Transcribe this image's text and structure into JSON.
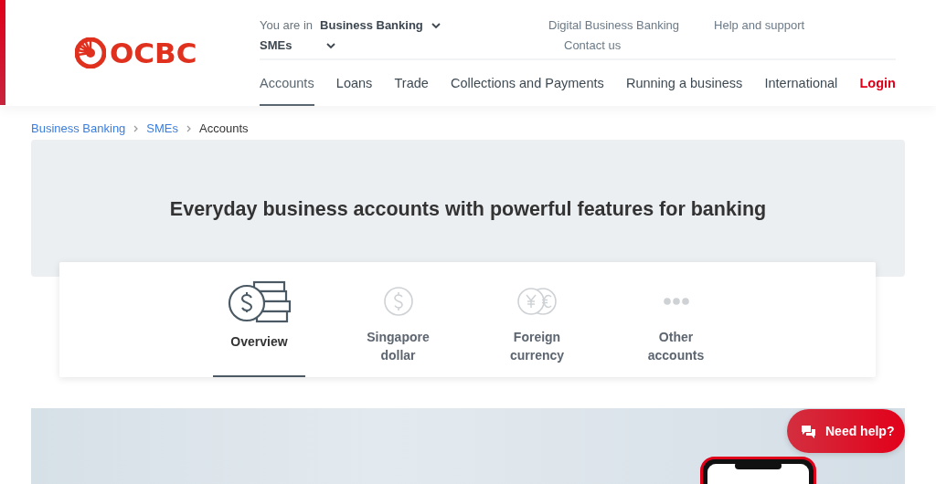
{
  "header": {
    "logo_text": "OCBC",
    "context_label": "You are in",
    "context_value": "Business Banking",
    "segment": "SMEs",
    "utility_links": [
      "Digital Business Banking",
      "Help and support",
      "Contact us"
    ],
    "nav": [
      {
        "label": "Accounts",
        "selected": true
      },
      {
        "label": "Loans",
        "selected": false
      },
      {
        "label": "Trade",
        "selected": false
      },
      {
        "label": "Collections and Payments",
        "selected": false
      },
      {
        "label": "Running a business",
        "selected": false
      },
      {
        "label": "International",
        "selected": false
      }
    ],
    "login": "Login"
  },
  "breadcrumb": [
    {
      "label": "Business Banking",
      "current": false
    },
    {
      "label": "SMEs",
      "current": false
    },
    {
      "label": "Accounts",
      "current": true
    }
  ],
  "hero": {
    "title": "Everyday business accounts with powerful features for banking"
  },
  "account_tabs": [
    {
      "label": "Overview",
      "kind": "overview",
      "selected": true
    },
    {
      "label": "Singapore dollar",
      "kind": "sgd",
      "selected": false
    },
    {
      "label": "Foreign currency",
      "kind": "fx",
      "selected": false
    },
    {
      "label": "Other accounts",
      "kind": "other",
      "selected": false
    }
  ],
  "help_button": {
    "label": "Need help?"
  }
}
